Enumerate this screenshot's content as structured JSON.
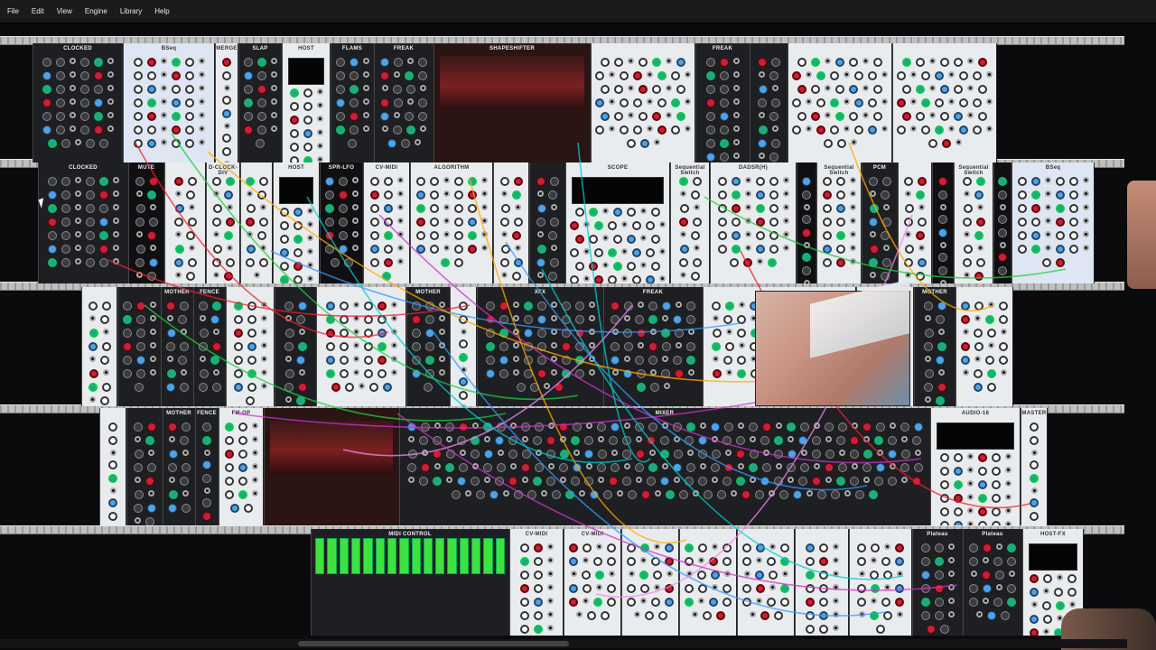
{
  "menu": [
    "File",
    "Edit",
    "View",
    "Engine",
    "Library",
    "Help"
  ],
  "rows": [
    {
      "name": "row-1",
      "modules": [
        {
          "label": "CLOCKED",
          "style": "dark",
          "w": 100
        },
        {
          "label": "BSeq",
          "style": "blue",
          "w": 102
        },
        {
          "label": "MERGE",
          "style": "light",
          "w": 26
        },
        {
          "label": "SLAP",
          "style": "dark",
          "w": 48
        },
        {
          "label": "HOST",
          "style": "light",
          "w": 54
        },
        {
          "label": "FLAMS",
          "style": "dark",
          "w": 48
        },
        {
          "label": "FREAK",
          "style": "dark",
          "w": 66
        },
        {
          "label": "SHAPESHIFTER",
          "style": "screen",
          "w": 174
        },
        {
          "label": "",
          "style": "light",
          "w": 116
        },
        {
          "label": "FREAK",
          "style": "dark",
          "w": 60
        },
        {
          "label": "",
          "style": "dark",
          "w": 42
        },
        {
          "label": "",
          "style": "light",
          "w": 116
        },
        {
          "label": "",
          "style": "light",
          "w": 116
        }
      ]
    },
    {
      "name": "row-2",
      "modules": [
        {
          "label": "CLOCKED",
          "style": "dark",
          "w": 100
        },
        {
          "label": "MUTE",
          "style": "black",
          "w": 40
        },
        {
          "label": "",
          "style": "light",
          "w": 46
        },
        {
          "label": "D-CLOCK-DIV",
          "style": "light",
          "w": 38
        },
        {
          "label": "",
          "style": "light",
          "w": 36
        },
        {
          "label": "HOST",
          "style": "light",
          "w": 52
        },
        {
          "label": "SPR-LFO",
          "style": "black",
          "w": 48
        },
        {
          "label": "CV-MIDI",
          "style": "light",
          "w": 52
        },
        {
          "label": "ALGORITHM",
          "style": "light",
          "w": 92
        },
        {
          "label": "",
          "style": "light",
          "w": 40
        },
        {
          "label": "",
          "style": "dark",
          "w": 40
        },
        {
          "label": "SCOPE",
          "style": "light",
          "w": 116
        },
        {
          "label": "Sequential Switch",
          "style": "light",
          "w": 44
        },
        {
          "label": "DADSR(H)",
          "style": "light",
          "w": 96
        },
        {
          "label": "",
          "style": "black",
          "w": 22
        },
        {
          "label": "Sequential Switch",
          "style": "light",
          "w": 50
        },
        {
          "label": "PCM",
          "style": "dark",
          "w": 40
        },
        {
          "label": "",
          "style": "light",
          "w": 38
        },
        {
          "label": "",
          "style": "black",
          "w": 24
        },
        {
          "label": "Sequential Switch",
          "style": "light",
          "w": 44
        },
        {
          "label": "",
          "style": "black",
          "w": 20
        },
        {
          "label": "BSeq",
          "style": "blue",
          "w": 92
        }
      ]
    },
    {
      "name": "row-3",
      "modules": [
        {
          "label": "",
          "style": "light",
          "w": 40
        },
        {
          "label": "",
          "style": "dark",
          "w": 48
        },
        {
          "label": "MOTHER",
          "style": "dark",
          "w": 36
        },
        {
          "label": "FENCE",
          "style": "dark",
          "w": 36
        },
        {
          "label": "",
          "style": "light",
          "w": 54
        },
        {
          "label": "",
          "style": "dark",
          "w": 46
        },
        {
          "label": "",
          "style": "light",
          "w": 100
        },
        {
          "label": "MOTHER",
          "style": "dark",
          "w": 48
        },
        {
          "label": "",
          "style": "light",
          "w": 30
        },
        {
          "label": "XFX",
          "style": "dark",
          "w": 140
        },
        {
          "label": "FREAK",
          "style": "dark",
          "w": 110
        },
        {
          "label": "",
          "style": "light",
          "w": 170
        },
        {
          "label": "",
          "style": "light",
          "w": 64
        },
        {
          "label": "MOTHER",
          "style": "dark",
          "w": 46
        },
        {
          "label": "",
          "style": "light",
          "w": 64
        }
      ]
    },
    {
      "name": "row-4",
      "modules": [
        {
          "label": "",
          "style": "light",
          "w": 30
        },
        {
          "label": "",
          "style": "dark",
          "w": 40
        },
        {
          "label": "MOTHER",
          "style": "dark",
          "w": 36
        },
        {
          "label": "FENCE",
          "style": "dark",
          "w": 26
        },
        {
          "label": "FM-OP",
          "style": "light",
          "w": 50
        },
        {
          "label": "",
          "style": "screen",
          "w": 150
        },
        {
          "label": "MIXER",
          "style": "dark",
          "w": 588
        },
        {
          "label": "AUDIO-16",
          "style": "light",
          "w": 100
        },
        {
          "label": "MASTER",
          "style": "light",
          "w": 30
        }
      ]
    },
    {
      "name": "row-5",
      "modules": [
        {
          "label": "MIDI CONTROL",
          "style": "dark",
          "w": 220
        },
        {
          "label": "CV-MIDI",
          "style": "light",
          "w": 60
        },
        {
          "label": "CV-MIDI",
          "style": "light",
          "w": 64
        },
        {
          "label": "",
          "style": "light",
          "w": 64
        },
        {
          "label": "",
          "style": "light",
          "w": 64
        },
        {
          "label": "",
          "style": "light",
          "w": 64
        },
        {
          "label": "",
          "style": "light",
          "w": 60
        },
        {
          "label": "",
          "style": "light",
          "w": 70
        },
        {
          "label": "Plateau",
          "style": "dark",
          "w": 56
        },
        {
          "label": "Plateau",
          "style": "dark",
          "w": 66
        },
        {
          "label": "HOST-FX",
          "style": "light",
          "w": 68
        }
      ]
    }
  ]
}
